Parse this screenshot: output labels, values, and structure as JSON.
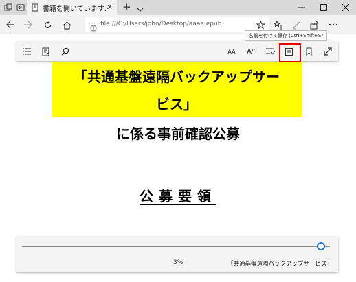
{
  "tab": {
    "title": "書籍を開いています..."
  },
  "address": {
    "url": "file:///C:/Users/joho/Desktop/aaaa.epub"
  },
  "tooltip": {
    "text": "名前を付けて保存 (Ctrl+Shift+S)"
  },
  "reading_toolbar": {
    "text_options_label": "AA",
    "read_aloud_label": "A⁾⁾"
  },
  "content": {
    "line1": "「共通基盤遠隔バックアップサー",
    "line2": "ビス」",
    "line3": "に係る事前確認公募",
    "line4": "公募要領"
  },
  "progress": {
    "value": 0.97,
    "percent_text": "3%",
    "chapter_title": "「共通基盤遠隔バックアップサービス」"
  },
  "colors": {
    "highlight": "#ffff00",
    "accent": "#1a73c7",
    "save_outline": "#e00000"
  }
}
